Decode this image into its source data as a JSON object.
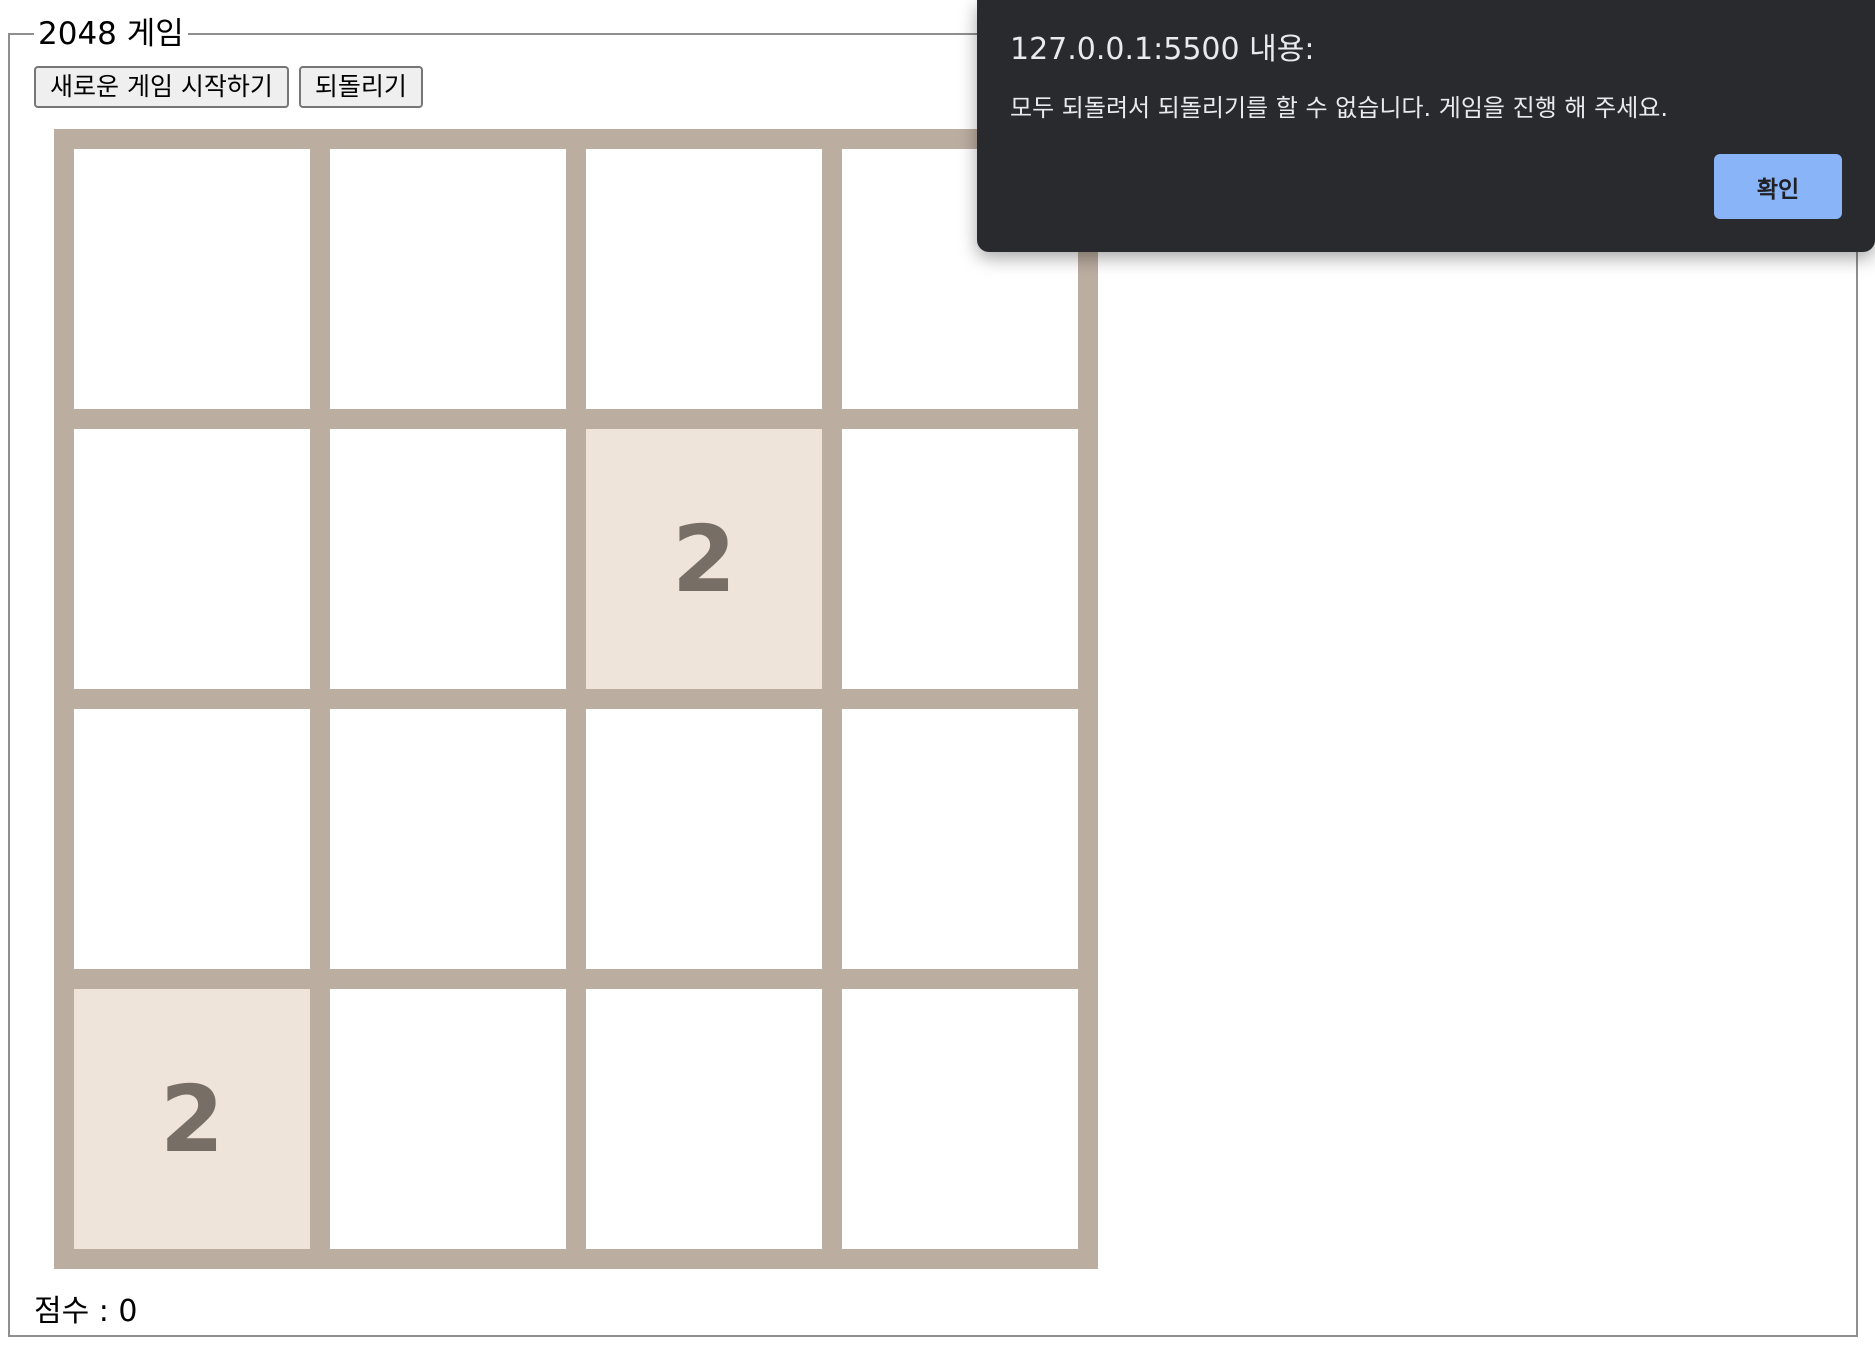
{
  "fieldset": {
    "legend": "2048 게임"
  },
  "toolbar": {
    "new_game_label": "새로운 게임 시작하기",
    "undo_label": "되돌리기"
  },
  "board": {
    "rows": [
      [
        "",
        "",
        "",
        ""
      ],
      [
        "",
        "",
        "2",
        ""
      ],
      [
        "",
        "",
        "",
        ""
      ],
      [
        "2",
        "",
        "",
        ""
      ]
    ]
  },
  "score": {
    "text": "점수 : 0"
  },
  "alert": {
    "title": "127.0.0.1:5500 내용:",
    "message": "모두 되돌려서 되돌리기를 할 수 없습니다. 게임을 진행 해 주세요.",
    "ok_label": "확인"
  },
  "colors": {
    "board_bg": "#bbada0",
    "empty_cell": "#ffffff",
    "tile_2_bg": "#eee4da",
    "tile_text": "#776e65",
    "dialog_bg": "#292a2d",
    "dialog_button": "#8ab4f8"
  }
}
